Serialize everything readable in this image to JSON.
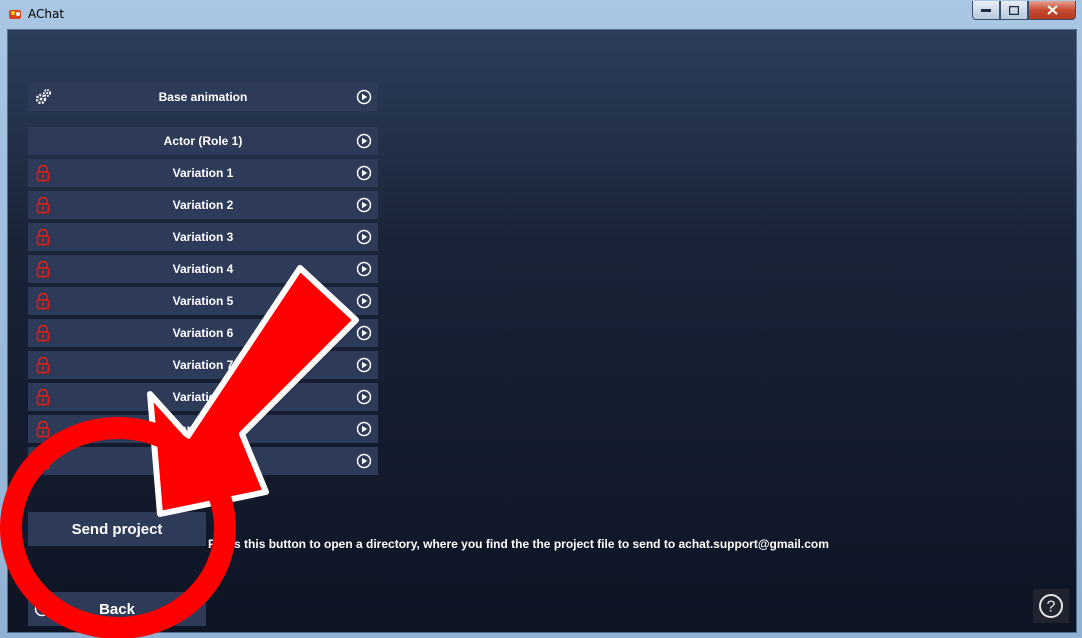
{
  "window": {
    "title": "AChat",
    "minimize_label": "minimize",
    "maximize_label": "maximize",
    "close_label": "close"
  },
  "list": {
    "base_animation": "Base animation",
    "actor": "Actor (Role 1)",
    "variations": [
      "Variation 1",
      "Variation 2",
      "Variation 3",
      "Variation 4",
      "Variation 5",
      "Variation 6",
      "Variation 7",
      "Variation 8",
      "Variation 9",
      "Variation 10"
    ]
  },
  "buttons": {
    "send_project": "Send project",
    "back": "Back",
    "help": "?"
  },
  "info": {
    "text": "Press this button to open a directory, where you find the the project file to send to achat.support@gmail.com"
  },
  "icons": {
    "base": "gears-icon",
    "lock": "lock-icon",
    "play": "play-circle-icon",
    "back": "back-arrow-icon",
    "help": "help-icon"
  },
  "colors": {
    "row_bg": "#2e3b58",
    "lock": "#d41f1f",
    "annotation_red": "#ff0000"
  }
}
